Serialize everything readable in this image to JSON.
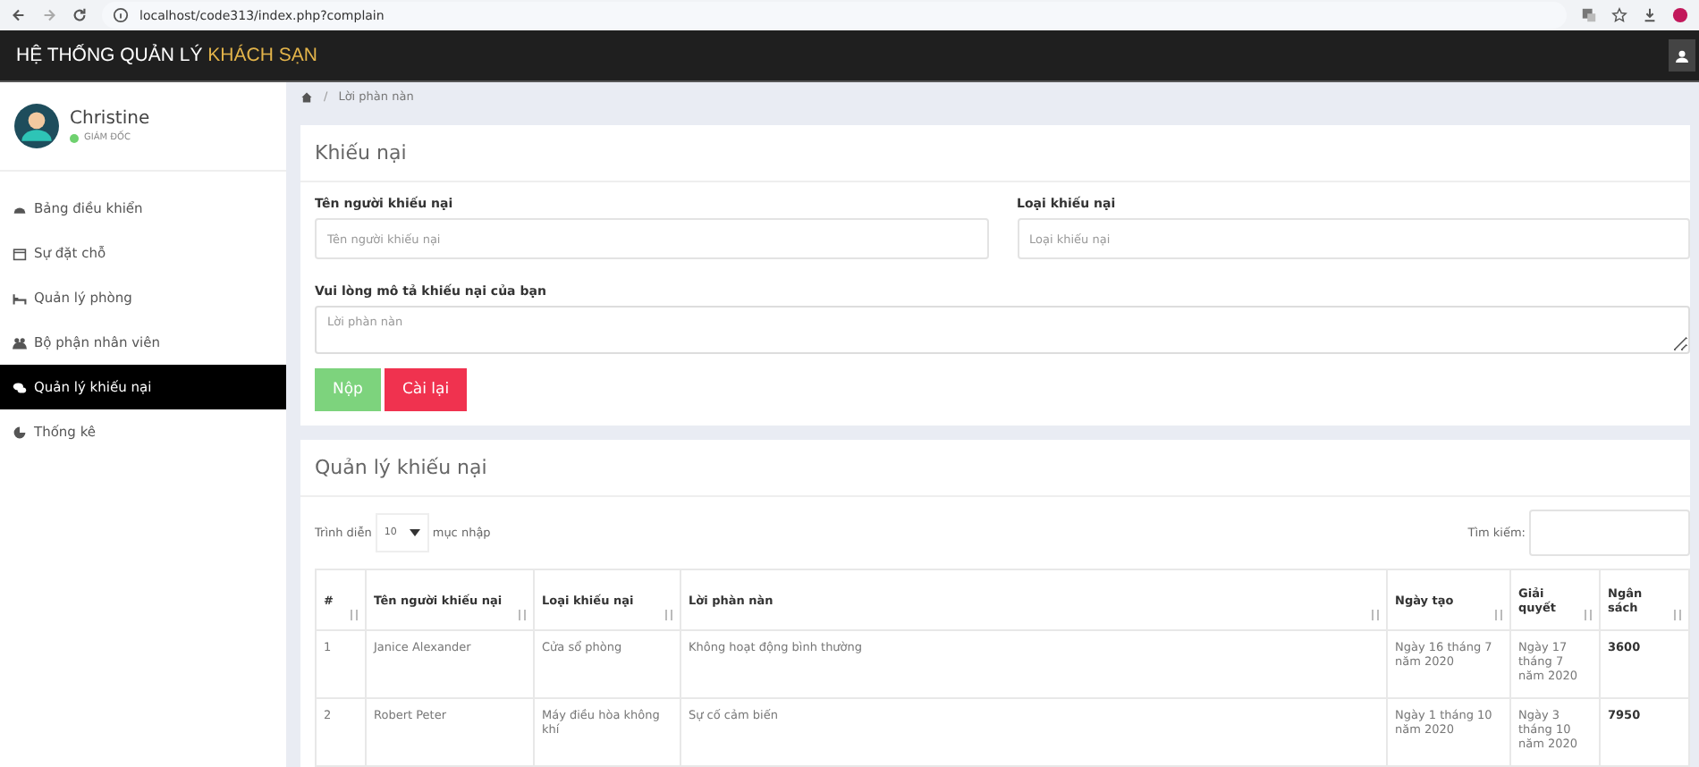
{
  "browser": {
    "url": "localhost/code313/index.php?complain"
  },
  "header": {
    "title_plain": "HỆ THỐNG QUẢN LÝ",
    "title_accent": "KHÁCH SẠN"
  },
  "user": {
    "name": "Christine",
    "role": "GIÁM ĐỐC",
    "online": true
  },
  "sidebar": {
    "items": [
      {
        "label": "Bảng điều khiển",
        "selected": false
      },
      {
        "label": "Sự đặt chỗ",
        "selected": false
      },
      {
        "label": "Quản lý phòng",
        "selected": false
      },
      {
        "label": "Bộ phận nhân viên",
        "selected": false
      },
      {
        "label": "Quản lý khiếu nại",
        "selected": true
      },
      {
        "label": "Thống kê",
        "selected": false
      }
    ]
  },
  "breadcrumb": {
    "separator": "/",
    "current": "Lời phàn nàn"
  },
  "form": {
    "title": "Khiếu nại",
    "fields": [
      {
        "label": "Tên người khiếu nại",
        "placeholder": "Tên người khiếu nại"
      },
      {
        "label": "Loại khiếu nại",
        "placeholder": "Loại khiếu nại"
      }
    ],
    "description": {
      "label": "Vui lòng mô tả khiếu nại của bạn",
      "placeholder": "Lời phàn nàn"
    },
    "buttons": [
      {
        "label": "Nộp",
        "kind": "submit"
      },
      {
        "label": "Cài lại",
        "kind": "reset"
      }
    ]
  },
  "table_panel": {
    "title": "Quản lý khiếu nại",
    "show_label": "Trình diễn",
    "page_size": "10",
    "entries_label": "mục nhập",
    "search_label": "Tìm kiếm:",
    "columns": [
      "#",
      "Tên người khiếu nại",
      "Loại khiếu nại",
      "Lời phàn nàn",
      "Ngày tạo",
      "Giải quyết",
      "Ngân sách"
    ],
    "rows": [
      {
        "cells": [
          "1",
          "Janice Alexander",
          "Cửa sổ phòng",
          "Không hoạt động bình thường",
          "Ngày 16 tháng 7 năm 2020",
          "Ngày 17 tháng 7 năm 2020",
          "3600"
        ]
      },
      {
        "cells": [
          "2",
          "Robert Peter",
          "Máy điều hòa không khí",
          "Sự cố cảm biến",
          "Ngày 1 tháng 10 năm 2020",
          "Ngày 3 tháng 10 năm 2020",
          "7950"
        ]
      }
    ]
  }
}
